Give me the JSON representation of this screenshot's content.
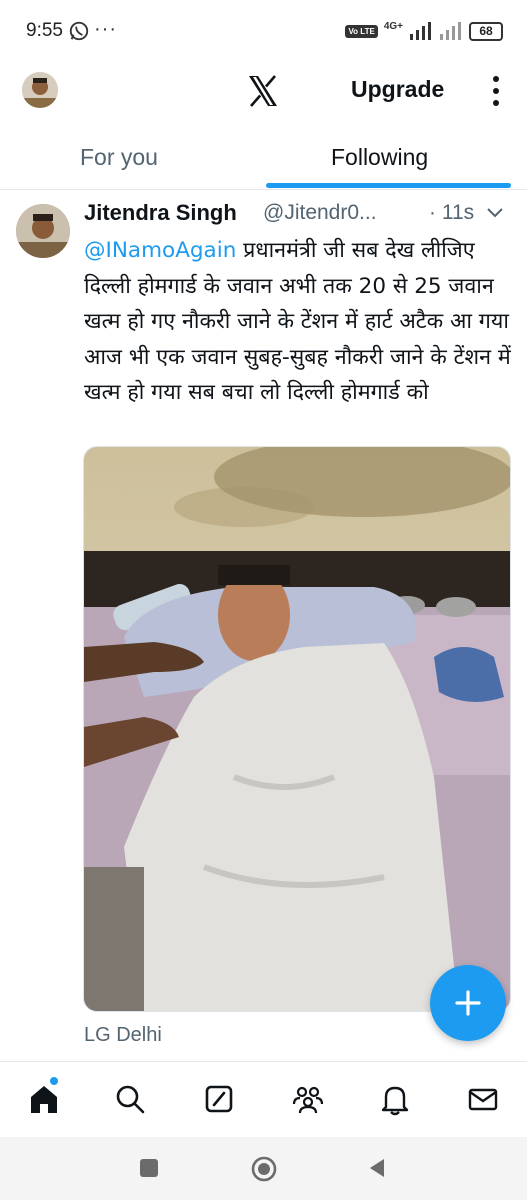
{
  "status_bar": {
    "time": "9:55",
    "network": "4G+",
    "volte": "Vo LTE",
    "battery": "68",
    "extra_dots": "···"
  },
  "app_bar": {
    "logo_icon": "x-logo-icon",
    "upgrade_label": "Upgrade"
  },
  "tabs": [
    {
      "label": "For you",
      "active": false
    },
    {
      "label": "Following",
      "active": true
    }
  ],
  "tweet": {
    "display_name": "Jitendra Singh",
    "handle": "@Jitendr0...",
    "time": "· 11s",
    "mention": "@INamoAgain",
    "text": " प्रधानमंत्री जी सब देख लीजिए दिल्ली होमगार्ड के जवान अभी तक 20 से 25 जवान खत्म हो गए नौकरी जाने के टेंशन में हार्ट अटैक आ गया आज भी एक जवान सुबह-सुबह नौकरी जाने के टेंशन में खत्म हो गया सब बचा लो दिल्ली होमगार्ड को",
    "location": "LG Delhi"
  },
  "fab": {
    "icon": "plus-icon"
  },
  "bottom_nav": [
    "home-icon",
    "search-icon",
    "grok-icon",
    "communities-icon",
    "notifications-icon",
    "messages-icon"
  ],
  "system_nav": [
    "recents-icon",
    "home-circle-icon",
    "back-icon"
  ],
  "colors": {
    "accent": "#1d9bf0",
    "text": "#0f1419",
    "secondary": "#536471"
  }
}
